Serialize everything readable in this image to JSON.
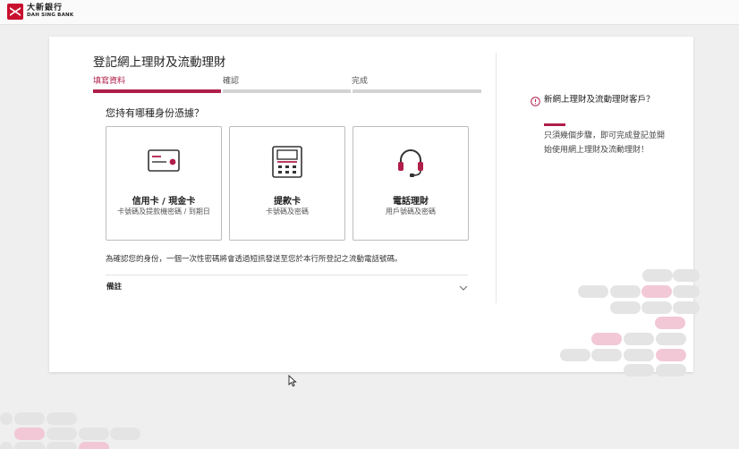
{
  "header": {
    "brand_cn": "大新銀行",
    "brand_en": "DAH SING BANK"
  },
  "main": {
    "title": "登記網上理財及流動理財",
    "steps": [
      {
        "label": "填寫資料",
        "active": true
      },
      {
        "label": "確認",
        "active": false
      },
      {
        "label": "完成",
        "active": false
      }
    ],
    "question": "您持有哪種身份憑據？",
    "options": [
      {
        "title": "信用卡 / 現金卡",
        "subtitle": "卡號碼及提款機密碼 / 到期日",
        "icon": "credit-card-icon"
      },
      {
        "title": "提款卡",
        "subtitle": "卡號碼及密碼",
        "icon": "atm-icon"
      },
      {
        "title": "電話理財",
        "subtitle": "用戶號碼及密碼",
        "icon": "headset-icon"
      }
    ],
    "verify_note": "為確認您的身份，一個一次性密碼將會透過短訊發送至您於本行所登記之流動電話號碼。",
    "remarks_label": "備註"
  },
  "side": {
    "title": "新網上理財及流動理財客戶？",
    "description": "只須幾個步驟，即可完成登記並開始使用網上理財及流動理財！"
  },
  "colors": {
    "accent": "#b01e4a",
    "step_inactive": "#d3d3d3",
    "pill_grey": "#e4e4e4",
    "pill_pink": "#f2c8d6"
  }
}
